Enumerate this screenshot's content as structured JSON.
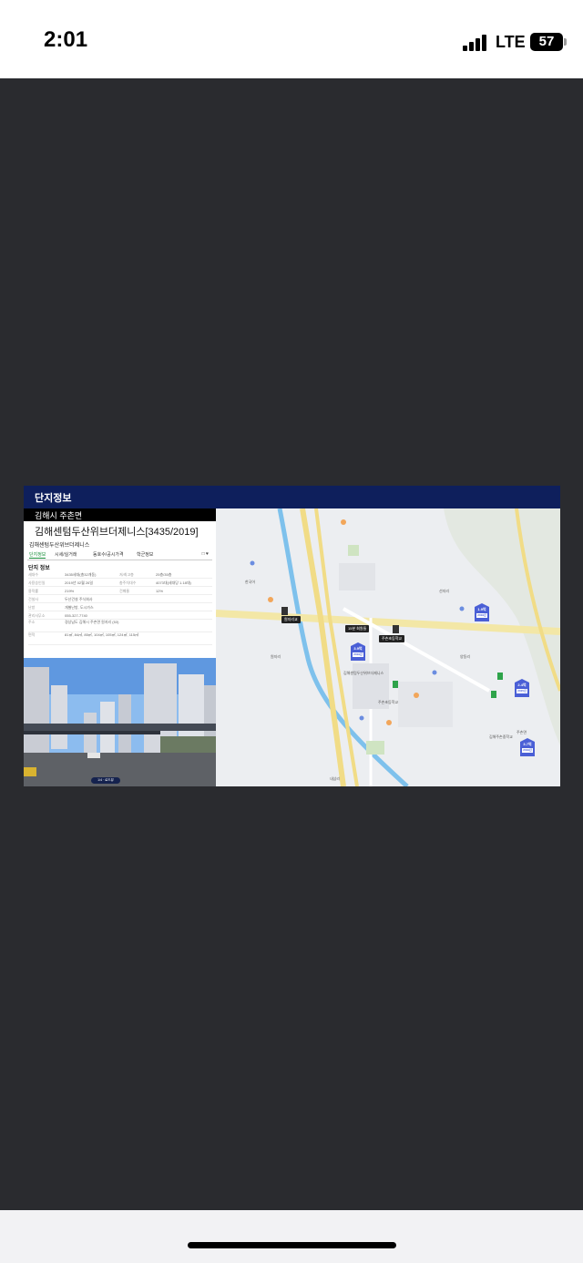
{
  "status": {
    "time": "2:01",
    "network": "LTE",
    "battery": "57"
  },
  "slide": {
    "header": "단지정보",
    "region": "김해시 주촌면",
    "complex_title": "김해센텀두산위브더제니스[3435/2019]",
    "complex_subtitle": "김해센텀두산위브더제니스",
    "tabs": [
      "단지정보",
      "시세/실거래",
      "동호수/공시가격",
      "학군정보"
    ],
    "tab_icons": "□ ♥",
    "info_title": "단지 정보",
    "info_rows": [
      {
        "k": "세대수",
        "v": "3435세대(총32개동)",
        "k2": "저/최고층",
        "v2": "25층/35층"
      },
      {
        "k": "사용승인일",
        "v": "2019년 02월 26일",
        "k2": "총주차대수",
        "v2": "4073대(세대당 1.18대)"
      },
      {
        "k": "용적률",
        "v": "219%",
        "k2": "건폐율",
        "v2": "12%"
      },
      {
        "k": "건설사",
        "v": "두산건설 주식회사",
        "k2": "",
        "v2": ""
      },
      {
        "k": "난방",
        "v": "개별난방, 도시가스",
        "k2": "",
        "v2": ""
      },
      {
        "k": "관리사무소",
        "v": "055-327-7740",
        "k2": "",
        "v2": ""
      },
      {
        "k": "주소",
        "v": "경상남도 김해시 주촌면 원지리 (53)",
        "k2": "",
        "v2": ""
      },
      {
        "k": "면적",
        "v": "81㎡, 84㎡, 85㎡, 104㎡, 105㎡, 124㎡, 115㎡",
        "k2": "",
        "v2": ""
      }
    ],
    "street_view_label": "1/4 · 로드뷰"
  },
  "map": {
    "labels": [
      "한국어",
      "선지리",
      "원지리",
      "김해센텀두산위브더제니스",
      "주촌초등학교",
      "김해주촌중학교",
      "내삼리",
      "양동리",
      "주촌면"
    ],
    "markers": [
      {
        "price": "1.9억",
        "year": "2019년"
      },
      {
        "price": "3.9억",
        "year": "2019년"
      },
      {
        "price": "2.4억",
        "year": "2015년"
      },
      {
        "price": "3.7억",
        "year": "2019년"
      }
    ],
    "callouts": [
      "15분 회원들",
      "주촌초등학교",
      "원지리교"
    ]
  },
  "colors": {
    "header": "#0e1f5c",
    "marker": "#4a5fd6",
    "tab_active": "#1a8f3c"
  }
}
